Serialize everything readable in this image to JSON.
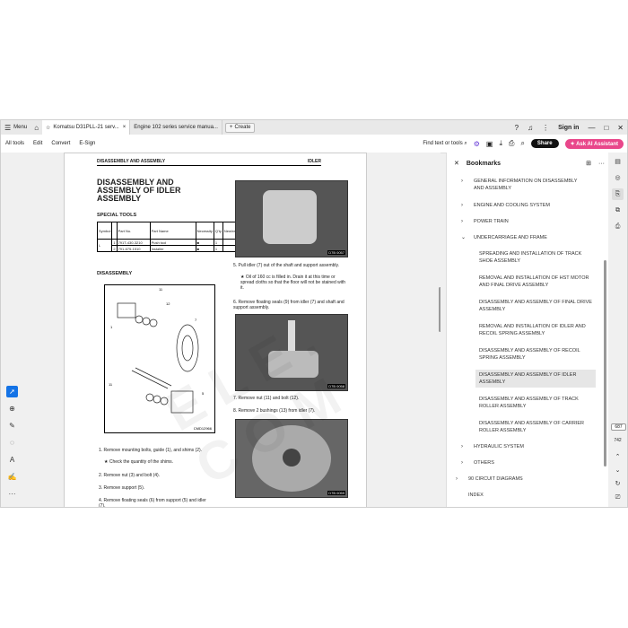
{
  "tabs": {
    "menu": "Menu",
    "tab1": "Komatsu D31PLL-21 serv...",
    "tab2": "Engine 102 series service manua...",
    "create": "Create"
  },
  "account": {
    "signin": "Sign in"
  },
  "toolbar": {
    "all_tools": "All tools",
    "edit": "Edit",
    "convert": "Convert",
    "esign": "E-Sign",
    "find": "Find text or tools",
    "share": "Share",
    "ai": "Ask AI Assistant"
  },
  "doc": {
    "header_left": "DISASSEMBLY AND ASSEMBLY",
    "header_right": "IDLER",
    "title": "DISASSEMBLY AND ASSEMBLY OF IDLER ASSEMBLY",
    "special_tools": "SPECIAL TOOLS",
    "tool_headers": [
      "Symbol",
      "Part No.",
      "Part Name",
      "Necessity",
      "Q'ty",
      "New/remodel",
      "Sketch"
    ],
    "tool_rows": [
      [
        "1",
        "791T-430-3210",
        "Push tool",
        "■",
        "1",
        "",
        ""
      ],
      [
        "2",
        "791-675-1510",
        "Installer",
        "■",
        "1",
        "",
        "□"
      ]
    ],
    "tool_symbol": "L",
    "disassembly": "DISASSEMBLY",
    "steps_left": [
      "1. Remove mounting bolts, guide (1), and shims (2).",
      "★ Check the quantity of the shims.",
      "2. Remove nut (3) and bolt (4).",
      "3. Remove support (5).",
      "4. Remove floating seals (6) from support (5) and idler (7)."
    ],
    "step5": "5. Pull idler (7) out of the shaft and support assembly.",
    "step5_note": "★ Oil of 160 cc is filled in. Drain it at this time or spread cloths so that the floor will not be stained with it.",
    "step6": "6. Remove floating seals (9) from idler (7) and shaft and support assembly.",
    "step7": "7. Remove nut (11) and bolt (12).",
    "step8": "8. Remove 2 bushings (13) from idler (7).",
    "fig1": "D7B 0057",
    "fig2": "D7B 0058",
    "fig3": "D7B 0059",
    "diag_label": "CMD12966",
    "watermark": "E L E . C O M"
  },
  "bookmarks": {
    "title": "Bookmarks",
    "items": [
      "GENERAL INFORMATION ON DISASSEMBLY AND ASSEMBLY",
      "ENGINE AND COOLING SYSTEM",
      "POWER TRAIN",
      "UNDERCARRIAGE AND FRAME",
      "SPREADING AND INSTALLATION OF TRACK SHOE ASSEMBLY",
      "REMOVAL AND INSTALLATION OF HST MOTOR AND FINAL DRIVE ASSEMBLY",
      "DISASSEMBLY AND ASSEMBLY OF FINAL DRIVE ASSEMBLY",
      "REMOVAL AND INSTALLATION OF IDLER AND RECOIL SPRING ASSEMBLY",
      "DISASSEMBLY AND ASSEMBLY OF RECOIL SPRING ASSEMBLY",
      "DISASSEMBLY AND ASSEMBLY OF IDLER ASSEMBLY",
      "DISASSEMBLY AND ASSEMBLY OF TRACK ROLLER ASSEMBLY",
      "DISASSEMBLY AND ASSEMBLY OF CARRIER ROLLER ASSEMBLY",
      "HYDRAULIC SYSTEM",
      "OTHERS",
      "90 CIRCUIT DIAGRAMS",
      "INDEX"
    ]
  },
  "pages": {
    "current": "687",
    "total": "742"
  }
}
